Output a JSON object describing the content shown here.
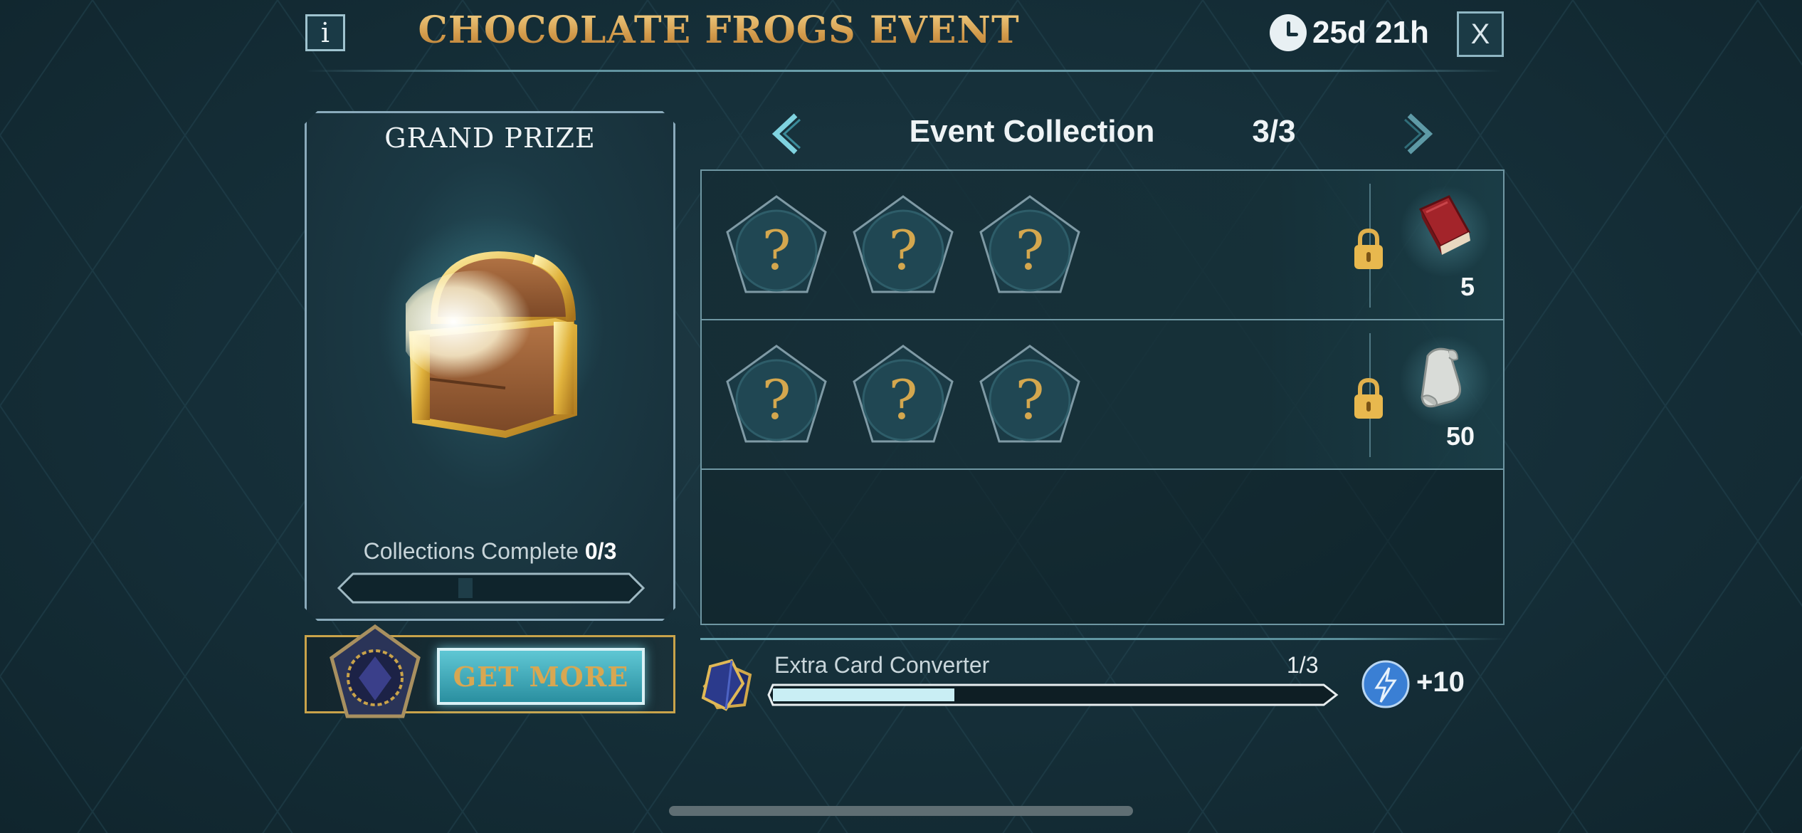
{
  "header": {
    "info_label": "i",
    "title": "CHOCOLATE FROGS EVENT",
    "timer": "25d 21h",
    "close_label": "X"
  },
  "grand_prize": {
    "title": "GRAND PRIZE",
    "collections_label": "Collections Complete",
    "collections_value": "0/3",
    "progress": 0
  },
  "get_more": {
    "button_label": "GET MORE"
  },
  "collection": {
    "title": "Event Collection",
    "count": "3/3",
    "rows": [
      {
        "cards": [
          "?",
          "?",
          "?"
        ],
        "locked": true,
        "reward": "book-icon",
        "reward_count": "5"
      },
      {
        "cards": [
          "?",
          "?",
          "?"
        ],
        "locked": true,
        "reward": "scroll-icon",
        "reward_count": "50"
      }
    ]
  },
  "converter": {
    "label": "Extra Card Converter",
    "count": "1/3",
    "progress": 0.33,
    "bonus": "+10"
  },
  "colors": {
    "gold": "#d9a752",
    "teal_accent": "#5fc7d4",
    "panel_border": "#8aaabb",
    "background": "#16303a"
  }
}
